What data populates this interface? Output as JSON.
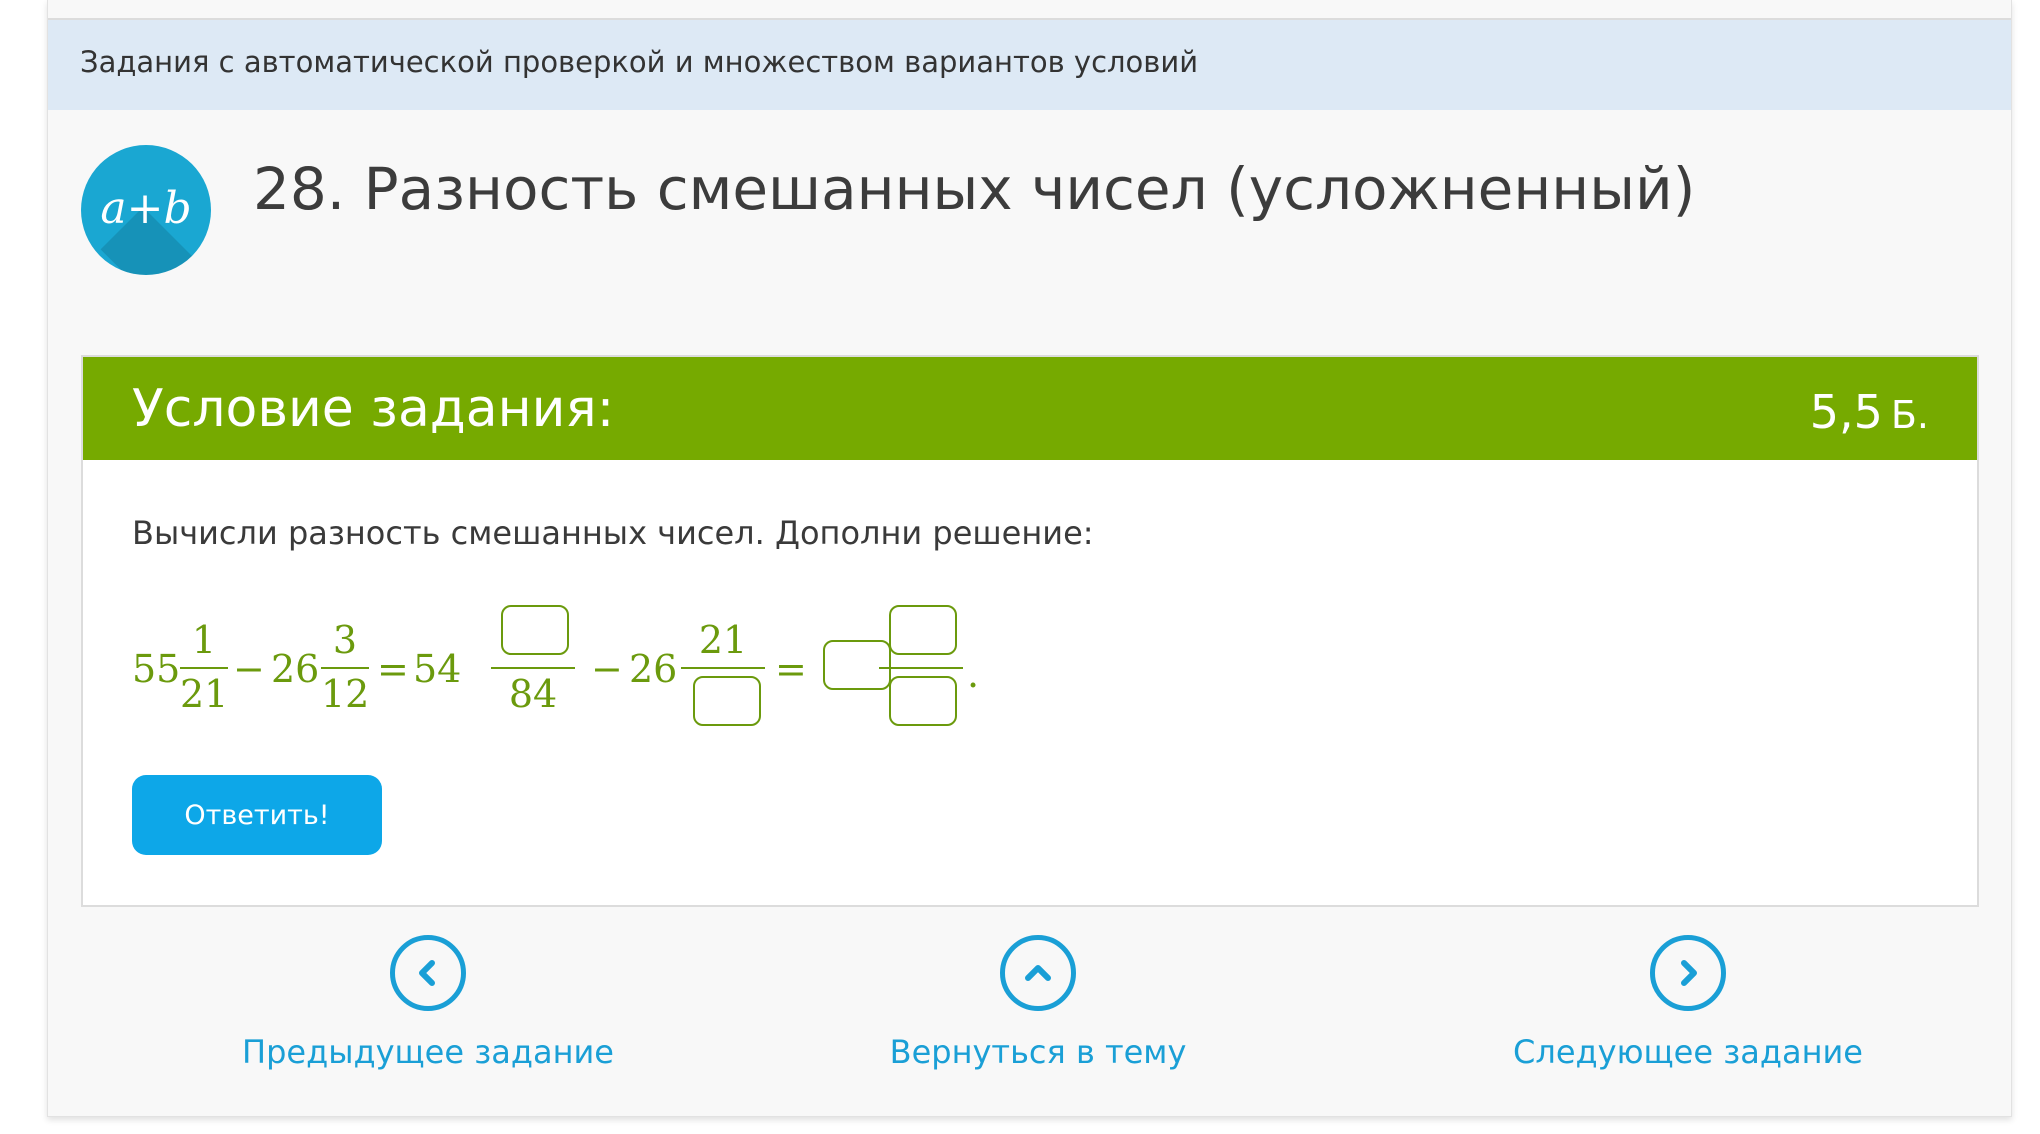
{
  "category": "Задания с автоматической проверкой и множеством вариантов условий",
  "avatar_text": "a+b",
  "page_title": "28. Разность смешанных чисел (усложненный)",
  "task": {
    "header_title": "Условие задания:",
    "points": "5,5",
    "points_unit": "Б.",
    "instruction": "Вычисли разность смешанных чисел. Дополни решение:",
    "expression": {
      "term1_whole": "55",
      "term1_num": "1",
      "term1_den": "21",
      "minus1": "−",
      "term2_whole": "26",
      "term2_num": "3",
      "term2_den": "12",
      "eq1": "=",
      "step_whole1": "54",
      "step_den1": "84",
      "minus2": "−",
      "step_whole2": "26",
      "step_num2": "21",
      "eq2": "=",
      "period": "."
    },
    "answer_button": "Ответить!"
  },
  "nav": {
    "prev_label": "Предыдущее задание",
    "up_label": "Вернуться в тему",
    "next_label": "Следующее задание"
  },
  "colors": {
    "header_green": "#76aa00",
    "math_green": "#6b9a0d",
    "accent_blue": "#0da7e8",
    "nav_blue": "#1a9fd6",
    "category_bg": "#dde9f5"
  }
}
